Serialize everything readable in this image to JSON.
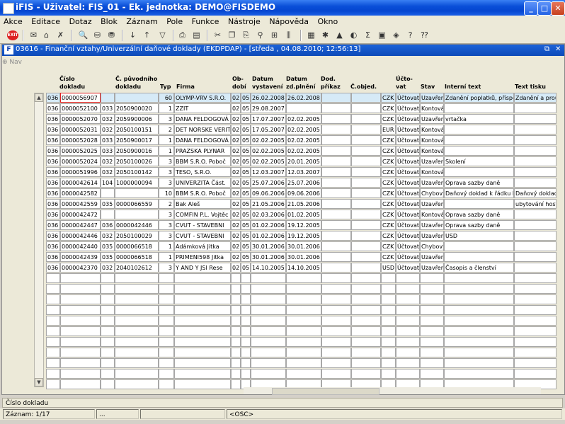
{
  "window": {
    "title": "iFIS - Uživatel: FIS_01 - Ek. jednotka: DEMO@FISDEMO",
    "min_btn": "_",
    "max_btn": "□",
    "close_btn": "✕"
  },
  "menu": [
    "Akce",
    "Editace",
    "Dotaz",
    "Blok",
    "Záznam",
    "Pole",
    "Funkce",
    "Nástroje",
    "Nápověda",
    "Okno"
  ],
  "toolbar": {
    "exit_label": "EXIT"
  },
  "form": {
    "title": "03616 - Finanční vztahy/Univerzální daňové doklady (EKDPDAP) - [středa , 04.08.2010; 12:56:13]",
    "title_icon": "F",
    "restore_btn": "⧉",
    "close_btn": "✕",
    "nav_label": "Nav"
  },
  "columns": {
    "cislo_dokladu": "Číslo\ndokladu",
    "c_puvodniho_dokladu": "Č. původního\ndokladu",
    "typ": "Typ",
    "firma": "Firma",
    "obdobi": "Ob-\ndobí",
    "datum_vystaveni": "Datum\nvystavení",
    "datum_zd_plneni": "Datum\nzd.plnění",
    "dod_prikaz": "Dod.\npříkaz",
    "c_objed": "Č.objed.",
    "ucto_vat": "Účto-\nvat",
    "stav": "Stav",
    "interni_text": "Interní text",
    "text_tisku": "Text tisku"
  },
  "rows": [
    [
      "036",
      "0000056907",
      "",
      "",
      "60",
      "OLYMP-VRV S.R.O.",
      "02",
      "05",
      "26.02.2008",
      "26.02.2008",
      "",
      "",
      "CZK",
      "Účtovat",
      "Uzavřen",
      "Zdanění poplatků, příspěv",
      "Zdanění a proúč"
    ],
    [
      "036",
      "0000052100",
      "033",
      "2050900020",
      "1",
      "ZZIT",
      "02",
      "05",
      "29.08.2007",
      "",
      "",
      "",
      "CZK",
      "Účtovat",
      "Kontová",
      "",
      ""
    ],
    [
      "036",
      "0000052070",
      "032",
      "2059900006",
      "3",
      "DANA FELDOGOVÁ",
      "02",
      "05",
      "17.07.2007",
      "02.02.2005",
      "",
      "",
      "CZK",
      "Účtovat",
      "Uzavřen",
      "vrtačka",
      ""
    ],
    [
      "036",
      "0000052031",
      "032",
      "2050100151",
      "2",
      "DET NORSKE VERIT",
      "02",
      "05",
      "17.05.2007",
      "02.02.2005",
      "",
      "",
      "EUR",
      "Účtovat",
      "Kontová",
      "",
      ""
    ],
    [
      "036",
      "0000052028",
      "033",
      "2050900017",
      "1",
      "DANA FELDOGOVÁ",
      "02",
      "05",
      "02.02.2005",
      "02.02.2005",
      "",
      "",
      "CZK",
      "Účtovat",
      "Kontová",
      "",
      ""
    ],
    [
      "036",
      "0000052025",
      "033",
      "2050900016",
      "1",
      "PRAZSKA PLYNAR",
      "02",
      "05",
      "02.02.2005",
      "02.02.2005",
      "",
      "",
      "CZK",
      "Účtovat",
      "Kontová",
      "",
      ""
    ],
    [
      "036",
      "0000052024",
      "032",
      "2050100026",
      "3",
      "BBM S.R.O. Poboč",
      "02",
      "05",
      "02.02.2005",
      "20.01.2005",
      "",
      "",
      "CZK",
      "Účtovat",
      "Uzavřen",
      "Skolení",
      ""
    ],
    [
      "036",
      "0000051996",
      "032",
      "2050100142",
      "3",
      "TESO, S.R.O.",
      "02",
      "05",
      "12.03.2007",
      "12.03.2007",
      "",
      "",
      "CZK",
      "Účtovat",
      "Kontová",
      "",
      ""
    ],
    [
      "036",
      "0000042614",
      "104",
      "1000000094",
      "3",
      "UNIVERZITA Část.",
      "02",
      "05",
      "25.07.2006",
      "25.07.2006",
      "",
      "",
      "CZK",
      "Účtovat",
      "Uzavřen",
      "Oprava sazby daně",
      ""
    ],
    [
      "036",
      "0000042582",
      "",
      "",
      "10",
      "BBM S.R.O. Poboč",
      "02",
      "05",
      "09.06.2006",
      "09.06.2006",
      "",
      "",
      "CZK",
      "Účtovat",
      "Chybový",
      "Daňový doklad k řádku ba",
      "Daňový doklad"
    ],
    [
      "036",
      "0000042559",
      "035",
      "0000066559",
      "2",
      "Bak Aleš",
      "02",
      "05",
      "21.05.2006",
      "21.05.2006",
      "",
      "",
      "CZK",
      "Účtovat",
      "Uzavřen",
      "",
      "ubytování hostů"
    ],
    [
      "036",
      "0000042472",
      "",
      "",
      "3",
      "COMFIN P.L. Vojtěc",
      "02",
      "05",
      "02.03.2006",
      "01.02.2005",
      "",
      "",
      "CZK",
      "Účtovat",
      "Kontová",
      "Oprava sazby daně",
      ""
    ],
    [
      "036",
      "0000042447",
      "036",
      "0000042446",
      "3",
      "CVUT - STAVEBNI",
      "02",
      "05",
      "01.02.2006",
      "19.12.2005",
      "",
      "",
      "CZK",
      "Účtovat",
      "Uzavřen",
      "Oprava sazby daně",
      ""
    ],
    [
      "036",
      "0000042446",
      "032",
      "2050100029",
      "3",
      "CVUT - STAVEBNI",
      "02",
      "05",
      "01.02.2006",
      "19.12.2005",
      "",
      "",
      "CZK",
      "Účtovat",
      "Uzavřen",
      "USD",
      ""
    ],
    [
      "036",
      "0000042440",
      "035",
      "0000066518",
      "1",
      "Adámková Jitka",
      "02",
      "05",
      "30.01.2006",
      "30.01.2006",
      "",
      "",
      "CZK",
      "Účtovat",
      "Chybový",
      "",
      ""
    ],
    [
      "036",
      "0000042439",
      "035",
      "0000066518",
      "1",
      "PRIMENI598 Jitka",
      "02",
      "05",
      "30.01.2006",
      "30.01.2006",
      "",
      "",
      "CZK",
      "Účtovat",
      "Uzavřen",
      "",
      ""
    ],
    [
      "036",
      "0000042370",
      "032",
      "2040102612",
      "3",
      "Y AND Y JSI Rese",
      "02",
      "05",
      "14.10.2005",
      "14.10.2005",
      "",
      "",
      "USD",
      "Účtovat",
      "Uzavřen",
      "Časopis a členství",
      ""
    ]
  ],
  "empty_rows": 11,
  "status": {
    "field_label": "Číslo dokladu",
    "record": "Záznam: 1/17",
    "seg2": "...",
    "seg3": "",
    "osc": "<OSC>"
  },
  "colors": {
    "accent": "#0a4fd8",
    "active_row": "#d6eaf7",
    "current_cell_border": "#e02020"
  }
}
